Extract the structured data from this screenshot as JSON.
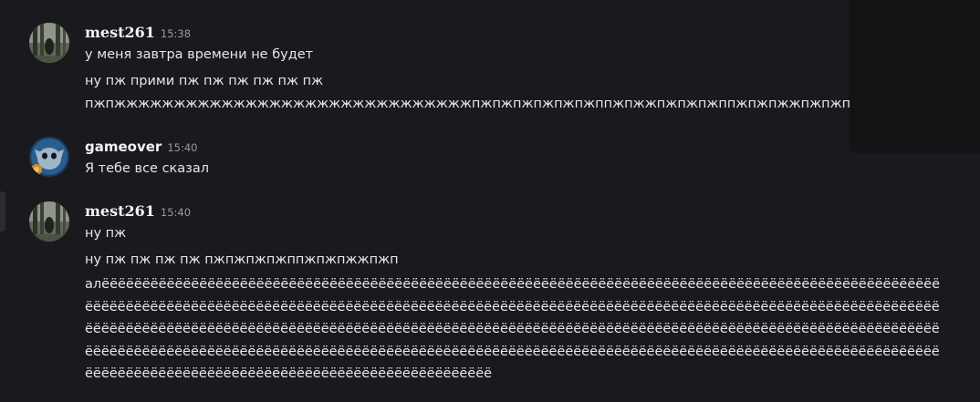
{
  "messages": [
    {
      "username": "mest261",
      "time": "15:38",
      "lines": [
        "у меня завтра времени не будет",
        "ну пж прими пж пж пж  пж пж пж",
        "пжпжжжжжжжжжжжжжжжжжжжжжжжжжжжжжжпжпжпжпжпжпжппжпжжпжпжпжппжпжпжжпжпжппжпжпжпжпжппжпжпжп"
      ]
    },
    {
      "username": "gameover",
      "time": "15:40",
      "lines": [
        "Я тебе все сказал"
      ]
    },
    {
      "username": "mest261",
      "time": "15:40",
      "lines": [
        "ну пж",
        "ну пж пж пж пж пжпжпжпжппжпжпжжпжп",
        "алёёёёёёёёёёёёёёёёёёёёёёёёёёёёёёёёёёёёёёёёёёёёёёёёёёёёёёёёёёёёёёёёёёёёёёёёёёёёёёёёёёёёёёёёёёёёёёёёёёёёёёёёёёёёёёёёёёёёёёёёёёёёёёёёёёёёёёёёёёёёёёёёёёёёёёёёёёёёёёёёёёёёёёёёёёёёёёёёёёёёёёёёёёёёёёёёёёёёёёёёёёёёёёёёёёёёёёёёёёёёёёёёёёёёёёёёёёёёёёёёёёёёёёёёёёёёёёёёёёёёёёёёёёёёёёёёёёёёёёёёёёёёёёёёёёёёёёёёёёёёёёёёёёёёёёёёёёёёёёёёёёёёёёёёёёёёёёёёёёёёёёёёёёёёёёёёёёёёёёёёёёёёёёёёёёёёёёёёёёёёёёёёёёёёёёёёёёёёёёёёёёёёёёёёёёёёёёёёёёёёёёёёёёёёёёёёёёёёёёёёёёёёёёёёёёёёёёёёёёёёёёёёёёёё"
      ]
    }
  ]
}
